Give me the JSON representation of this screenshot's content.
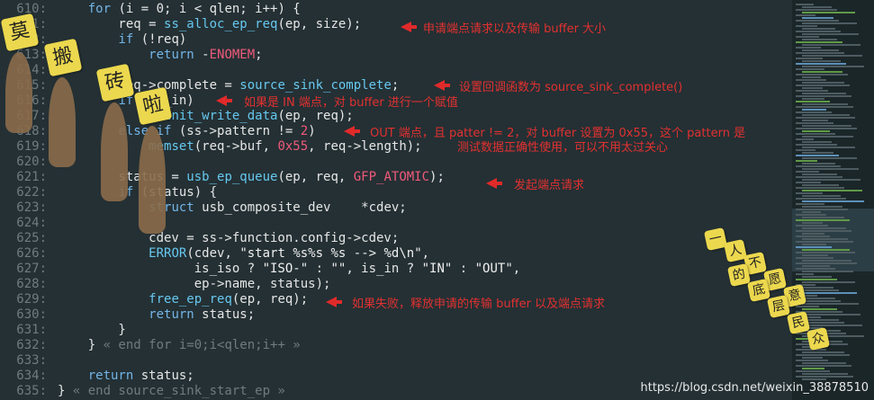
{
  "lines": [
    {
      "n": "610:",
      "code": "    for (i = 0; i < qlen; i++) {"
    },
    {
      "n": "611:",
      "code": "        req = ss_alloc_ep_req(ep, size);"
    },
    {
      "n": "612:",
      "code": "        if (!req)"
    },
    {
      "n": "613:",
      "code": "            return -ENOMEM;"
    },
    {
      "n": "614:",
      "code": ""
    },
    {
      "n": "615:",
      "code": "        req->complete = source_sink_complete;"
    },
    {
      "n": "616:",
      "code": "        if (is_in)"
    },
    {
      "n": "617:",
      "code": "            reinit_write_data(ep, req);"
    },
    {
      "n": "618:",
      "code": "        else if (ss->pattern != 2)"
    },
    {
      "n": "619:",
      "code": "            memset(req->buf, 0x55, req->length);"
    },
    {
      "n": "620:",
      "code": ""
    },
    {
      "n": "621:",
      "code": "        status = usb_ep_queue(ep, req, GFP_ATOMIC);"
    },
    {
      "n": "622:",
      "code": "        if (status) {"
    },
    {
      "n": "623:",
      "code": "            struct usb_composite_dev    *cdev;"
    },
    {
      "n": "624:",
      "code": ""
    },
    {
      "n": "625:",
      "code": "            cdev = ss->function.config->cdev;"
    },
    {
      "n": "626:",
      "code": "            ERROR(cdev, \"start %s%s %s --> %d\\n\","
    },
    {
      "n": "627:",
      "code": "                  is_iso ? \"ISO-\" : \"\", is_in ? \"IN\" : \"OUT\","
    },
    {
      "n": "628:",
      "code": "                  ep->name, status);"
    },
    {
      "n": "629:",
      "code": "            free_ep_req(ep, req);"
    },
    {
      "n": "630:",
      "code": "            return status;"
    },
    {
      "n": "631:",
      "code": "        }"
    },
    {
      "n": "632:",
      "code": "    } « end for i=0;i<qlen;i++ »"
    },
    {
      "n": "633:",
      "code": ""
    },
    {
      "n": "634:",
      "code": "    return status;"
    },
    {
      "n": "635:",
      "code": "} « end source_sink_start_ep »"
    }
  ],
  "annotations": [
    {
      "text": "申请端点请求以及传输 buffer 大小"
    },
    {
      "text": "设置回调函数为 source_sink_complete()"
    },
    {
      "text": "如果是 IN 端点，对 buffer 进行一个赋值"
    },
    {
      "text": "OUT 端点，且 patter != 2，对 buffer 设置为 0x55，这个 pattern 是"
    },
    {
      "text": "测试数据正确性使用，可以不用太过关心"
    },
    {
      "text": "发起端点请求"
    },
    {
      "text": "如果失败，释放申请的传输 buffer 以及端点请求"
    }
  ],
  "watermark": "https://blog.csdn.net/weixin_38878510",
  "stickers_left": [
    "莫",
    "搬",
    "砖",
    "啦"
  ],
  "stickers_right": [
    "一",
    "人",
    "不",
    "愿",
    "意",
    "的",
    "底",
    "层",
    "民",
    "众"
  ],
  "colors": {
    "background": "#243034",
    "keyword": "#73b5e7",
    "constant": "#f05a7a",
    "annotation": "#e23030"
  }
}
